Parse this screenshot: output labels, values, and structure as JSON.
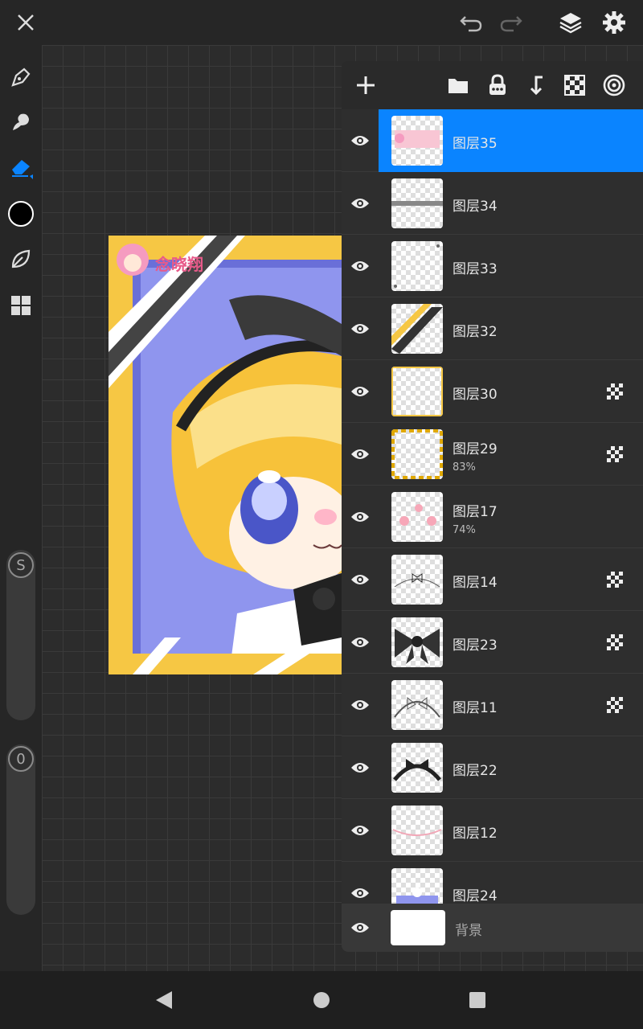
{
  "app": {
    "accent_color": "#0a84ff",
    "top_icons": [
      "close-icon",
      "undo-icon",
      "redo-icon",
      "layers-icon",
      "gear-icon"
    ]
  },
  "toolbar": {
    "tools": [
      "brush-icon",
      "smudge-icon",
      "eraser-icon",
      "color-swatch",
      "liquify-icon",
      "gallery-icon"
    ],
    "brush_size_label": "S",
    "opacity_label": "0"
  },
  "layers_panel": {
    "toolbar_icons": [
      "add-layer-icon",
      "folder-icon",
      "lock-icon",
      "merge-down-icon",
      "checkerboard-icon",
      "target-icon"
    ],
    "layers": [
      {
        "name": "图层35",
        "opacity": "",
        "clip": false,
        "selected": true
      },
      {
        "name": "图层34",
        "opacity": "",
        "clip": false,
        "selected": false
      },
      {
        "name": "图层33",
        "opacity": "",
        "clip": false,
        "selected": false
      },
      {
        "name": "图层32",
        "opacity": "",
        "clip": false,
        "selected": false
      },
      {
        "name": "图层30",
        "opacity": "",
        "clip": true,
        "selected": false
      },
      {
        "name": "图层29",
        "opacity": "83%",
        "clip": true,
        "selected": false
      },
      {
        "name": "图层17",
        "opacity": "74%",
        "clip": false,
        "selected": false
      },
      {
        "name": "图层14",
        "opacity": "",
        "clip": true,
        "selected": false
      },
      {
        "name": "图层23",
        "opacity": "",
        "clip": true,
        "selected": false
      },
      {
        "name": "图层11",
        "opacity": "",
        "clip": true,
        "selected": false
      },
      {
        "name": "图层22",
        "opacity": "",
        "clip": false,
        "selected": false
      },
      {
        "name": "图层12",
        "opacity": "",
        "clip": false,
        "selected": false
      },
      {
        "name": "图层24",
        "opacity": "",
        "clip": false,
        "selected": false
      }
    ],
    "background_layer": {
      "name": "背景"
    }
  },
  "artwork": {
    "signature_text": "念晓翔"
  },
  "nav": [
    "back-icon",
    "home-icon",
    "recents-icon"
  ]
}
